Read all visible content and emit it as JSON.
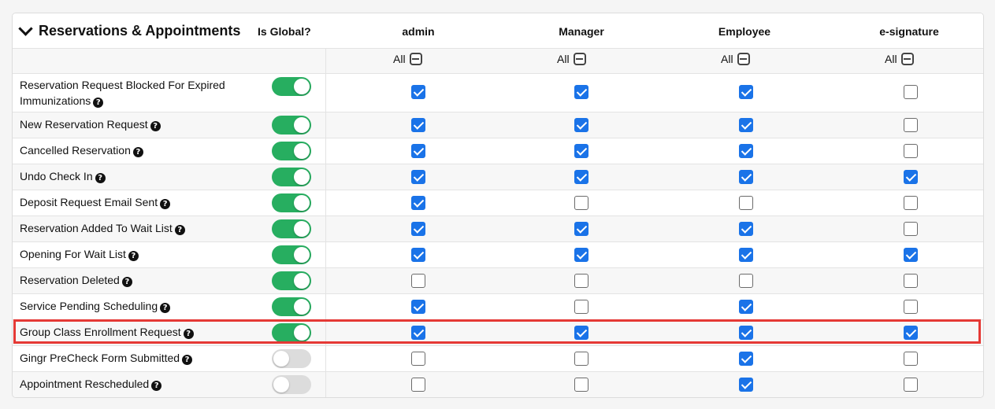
{
  "section": {
    "title": "Reservations & Appointments",
    "is_global_label": "Is Global?"
  },
  "columns": [
    {
      "label": "admin",
      "all_label": "All"
    },
    {
      "label": "Manager",
      "all_label": "All"
    },
    {
      "label": "Employee",
      "all_label": "All"
    },
    {
      "label": "e-signature",
      "all_label": "All"
    }
  ],
  "icons": {
    "collapse": "chevron-down-icon",
    "help": "question-circle-icon",
    "all_toggle": "minus-square-icon"
  },
  "colors": {
    "toggle_on": "#27ae60",
    "toggle_off": "#dcdcdc",
    "checkbox_checked": "#1a73e8",
    "highlight": "#e53935"
  },
  "rows": [
    {
      "label": "Reservation Request Blocked For Expired Immunizations",
      "global": true,
      "checks": [
        true,
        true,
        true,
        false
      ]
    },
    {
      "label": "New Reservation Request",
      "global": true,
      "checks": [
        true,
        true,
        true,
        false
      ]
    },
    {
      "label": "Cancelled Reservation",
      "global": true,
      "checks": [
        true,
        true,
        true,
        false
      ]
    },
    {
      "label": "Undo Check In",
      "global": true,
      "checks": [
        true,
        true,
        true,
        true
      ]
    },
    {
      "label": "Deposit Request Email Sent",
      "global": true,
      "checks": [
        true,
        false,
        false,
        false
      ]
    },
    {
      "label": "Reservation Added To Wait List",
      "global": true,
      "checks": [
        true,
        true,
        true,
        false
      ]
    },
    {
      "label": "Opening For Wait List",
      "global": true,
      "checks": [
        true,
        true,
        true,
        true
      ]
    },
    {
      "label": "Reservation Deleted",
      "global": true,
      "checks": [
        false,
        false,
        false,
        false
      ]
    },
    {
      "label": "Service Pending Scheduling",
      "global": true,
      "checks": [
        true,
        false,
        true,
        false
      ]
    },
    {
      "label": "Group Class Enrollment Request",
      "global": true,
      "checks": [
        true,
        true,
        true,
        true
      ],
      "highlighted": true
    },
    {
      "label": "Gingr PreCheck Form Submitted",
      "global": false,
      "checks": [
        false,
        false,
        true,
        false
      ]
    },
    {
      "label": "Appointment Rescheduled",
      "global": false,
      "checks": [
        false,
        false,
        true,
        false
      ]
    }
  ]
}
